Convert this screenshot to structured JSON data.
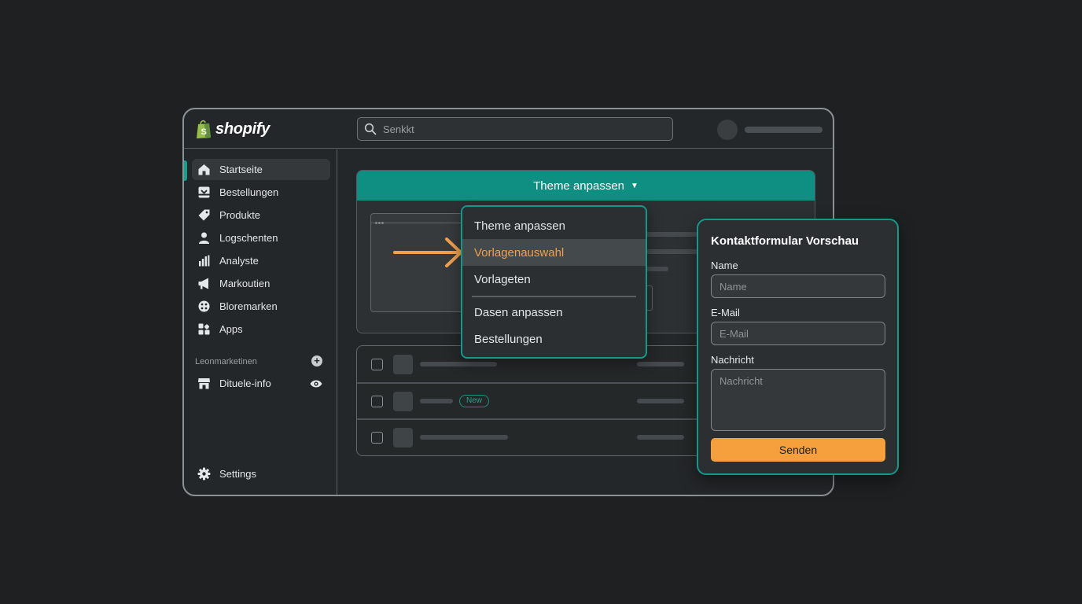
{
  "app": {
    "logo_text": "shopify"
  },
  "search": {
    "placeholder": "Senkkt"
  },
  "sidebar": {
    "items": [
      {
        "label": "Startseite",
        "icon": "home-icon"
      },
      {
        "label": "Bestellungen",
        "icon": "inbox-icon"
      },
      {
        "label": "Produkte",
        "icon": "tag-icon"
      },
      {
        "label": "Logschenten",
        "icon": "person-icon"
      },
      {
        "label": "Analyste",
        "icon": "bar-chart-icon"
      },
      {
        "label": "Markoutien",
        "icon": "megaphone-icon"
      },
      {
        "label": "Bloremarken",
        "icon": "discount-icon"
      },
      {
        "label": "Apps",
        "icon": "apps-icon"
      }
    ],
    "section_label": "Leonmarketinen",
    "channel": {
      "label": "Dituele-info",
      "icon": "store-icon"
    },
    "settings_label": "Settings"
  },
  "theme": {
    "header_label": "Theme anpassen"
  },
  "dropdown": {
    "items": [
      "Theme anpassen",
      "Vorlagenauswahl",
      "Vorlageten",
      "Dasen anpassen",
      "Bestellungen"
    ],
    "highlighted": "Vorlagenauswahl"
  },
  "table": {
    "badge": "New"
  },
  "form": {
    "title": "Kontaktformular Vorschau",
    "name_label": "Name",
    "name_placeholder": "Name",
    "email_label": "E-Mail",
    "email_placeholder": "E-Mail",
    "message_label": "Nachricht",
    "message_placeholder": "Nachricht",
    "submit_label": "Senden"
  },
  "colors": {
    "accent_teal": "#0f8f82",
    "highlight_orange": "#f0a04b",
    "button_orange": "#f5a03c",
    "background": "#1e2022"
  }
}
